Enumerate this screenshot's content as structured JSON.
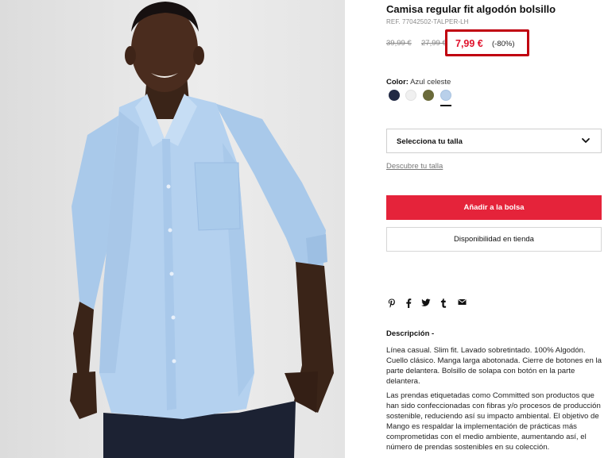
{
  "product": {
    "title": "Camisa regular fit algodón bolsillo",
    "ref": "REF. 77042502-TALPER-LH",
    "old_price_1": "39,99 €",
    "old_price_2": "27,99 €",
    "price": "7,99 €",
    "discount": "(-80%)"
  },
  "color": {
    "label": "Color:",
    "value": "Azul celeste",
    "swatches": [
      {
        "name": "navy",
        "hex": "#222a44"
      },
      {
        "name": "white",
        "hex": "#f0f0f0"
      },
      {
        "name": "olive",
        "hex": "#6a6a3a"
      },
      {
        "name": "sky-blue",
        "hex": "#b9d0ea",
        "selected": true
      }
    ]
  },
  "size": {
    "select_label": "Selecciona tu talla",
    "guide_link": "Descubre tu talla"
  },
  "actions": {
    "add_to_bag": "Añadir a la bolsa",
    "store_availability": "Disponibilidad en tienda"
  },
  "social": {
    "icons": [
      "pinterest-icon",
      "facebook-icon",
      "twitter-icon",
      "tumblr-icon",
      "email-icon"
    ],
    "glyphs": [
      "℗",
      "f",
      "🐦",
      "t",
      "✉"
    ]
  },
  "description": {
    "title": "Descripción -",
    "paragraph_1": "Línea casual. Slim fit. Lavado sobretintado. 100% Algodón. Cuello clásico. Manga larga abotonada. Cierre de botones en la parte delantera. Bolsillo de solapa con botón en la parte delantera.",
    "paragraph_2": "Las prendas etiquetadas como Committed son productos que han sido confeccionadas con fibras y/o procesos de producción sostenible, reduciendo así su impacto ambiental. El objetivo de Mango es respaldar la implementación de prácticas más comprometidas con el medio ambiente, aumentando así, el número de prendas sostenibles en su colección."
  },
  "colors": {
    "accent_red": "#e5233a",
    "highlight_border": "#c00010",
    "price_red": "#e0112b"
  }
}
